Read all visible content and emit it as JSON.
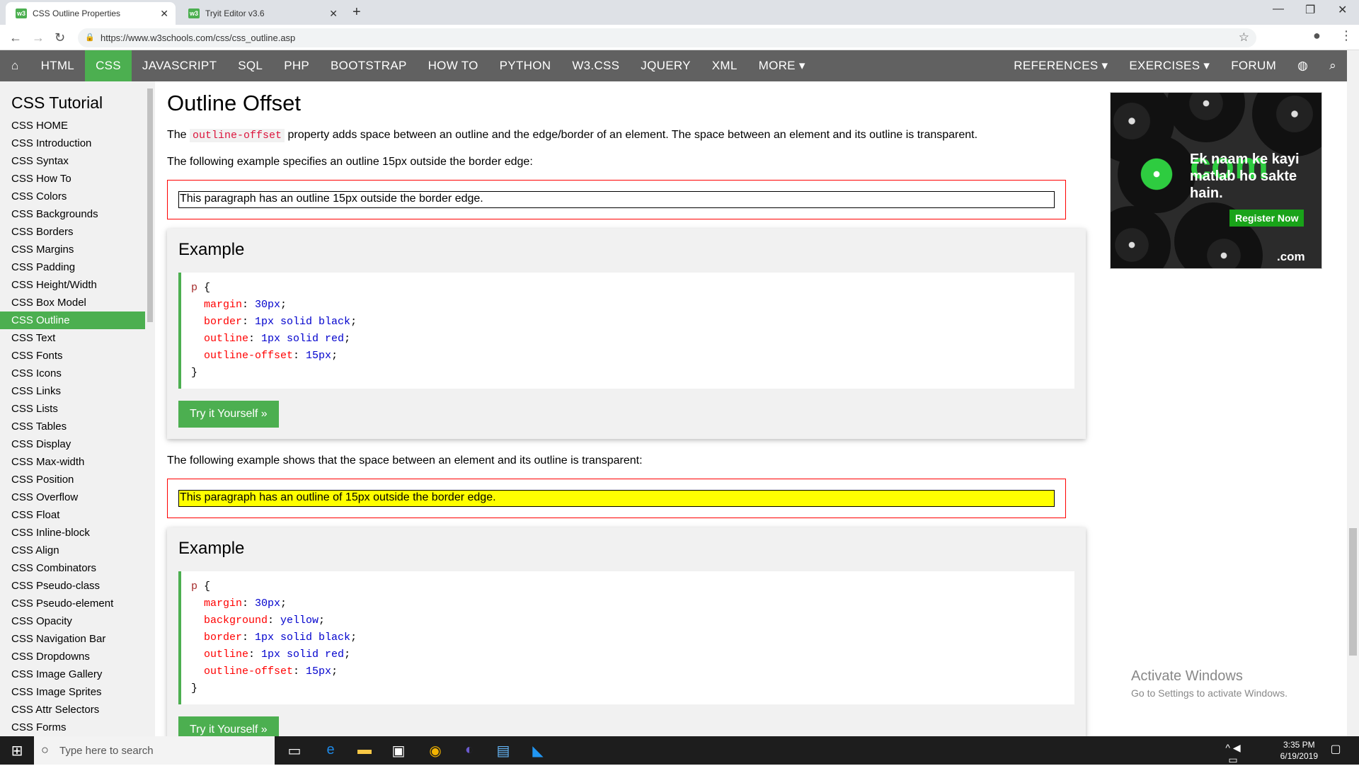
{
  "browser": {
    "tabs": [
      {
        "title": "CSS Outline Properties",
        "favicon": "w3-icon"
      },
      {
        "title": "Tryit Editor v3.6",
        "favicon": "w3-icon"
      }
    ],
    "url": "https://www.w3schools.com/css/css_outline.asp"
  },
  "topnav": {
    "left": [
      "HTML",
      "CSS",
      "JAVASCRIPT",
      "SQL",
      "PHP",
      "BOOTSTRAP",
      "HOW TO",
      "PYTHON",
      "W3.CSS",
      "JQUERY",
      "XML",
      "MORE ▾"
    ],
    "active": "CSS",
    "right": [
      "REFERENCES ▾",
      "EXERCISES ▾",
      "FORUM"
    ]
  },
  "sidebar": {
    "title": "CSS Tutorial",
    "links": [
      "CSS HOME",
      "CSS Introduction",
      "CSS Syntax",
      "CSS How To",
      "CSS Colors",
      "CSS Backgrounds",
      "CSS Borders",
      "CSS Margins",
      "CSS Padding",
      "CSS Height/Width",
      "CSS Box Model",
      "CSS Outline",
      "CSS Text",
      "CSS Fonts",
      "CSS Icons",
      "CSS Links",
      "CSS Lists",
      "CSS Tables",
      "CSS Display",
      "CSS Max-width",
      "CSS Position",
      "CSS Overflow",
      "CSS Float",
      "CSS Inline-block",
      "CSS Align",
      "CSS Combinators",
      "CSS Pseudo-class",
      "CSS Pseudo-element",
      "CSS Opacity",
      "CSS Navigation Bar",
      "CSS Dropdowns",
      "CSS Image Gallery",
      "CSS Image Sprites",
      "CSS Attr Selectors",
      "CSS Forms"
    ],
    "active": "CSS Outline"
  },
  "main": {
    "heading": "Outline Offset",
    "intro_pre": "The ",
    "intro_code": "outline-offset",
    "intro_post": " property adds space between an outline and the edge/border of an element. The space between an element and its outline is transparent.",
    "example1_intro": "The following example specifies an outline 15px outside the border edge:",
    "demo1": "This paragraph has an outline 15px outside the border edge.",
    "example_title": "Example",
    "try_label": "Try it Yourself »",
    "example2_intro": "The following example shows that the space between an element and its outline is transparent:",
    "demo2": "This paragraph has an outline of 15px outside the border edge.",
    "code1": [
      [
        "margin",
        "30px"
      ],
      [
        "border",
        "1px solid black"
      ],
      [
        "outline",
        "1px solid red"
      ],
      [
        "outline-offset",
        "15px"
      ]
    ],
    "code2": [
      [
        "margin",
        "30px"
      ],
      [
        "background",
        "yellow"
      ],
      [
        "border",
        "1px solid black"
      ],
      [
        "outline",
        "1px solid red"
      ],
      [
        "outline-offset",
        "15px"
      ]
    ]
  },
  "ad": {
    "brand": "com",
    "text": "Ek naam ke kayi matlab ho sakte hain.",
    "button": "Register Now",
    "logo": ".com"
  },
  "watermark": {
    "line1": "Activate Windows",
    "line2": "Go to Settings to activate Windows."
  },
  "taskbar": {
    "search_placeholder": "Type here to search",
    "time": "3:35 PM",
    "date": "6/19/2019"
  },
  "colors": {
    "accent": "#4CAF50",
    "nav": "#616161"
  }
}
